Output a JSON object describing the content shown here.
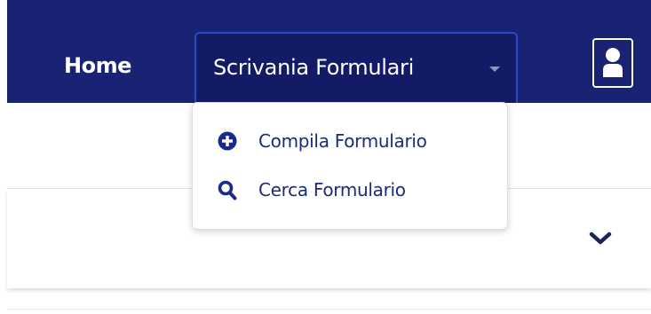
{
  "navbar": {
    "home_label": "Home",
    "dropdown_label": "Scrivania Formulari",
    "background_color": "#1a2373",
    "active_border_color": "#2f46c7"
  },
  "dropdown_menu": {
    "items": [
      {
        "label": "Compila Formulario",
        "icon": "plus-circle-icon"
      },
      {
        "label": "Cerca Formulario",
        "icon": "search-icon"
      }
    ],
    "text_color": "#1c2a7a",
    "icon_color": "#1a2a8a"
  },
  "user_menu": {
    "icon": "user-icon"
  },
  "card": {
    "toggle_icon": "chevron-down-icon"
  }
}
